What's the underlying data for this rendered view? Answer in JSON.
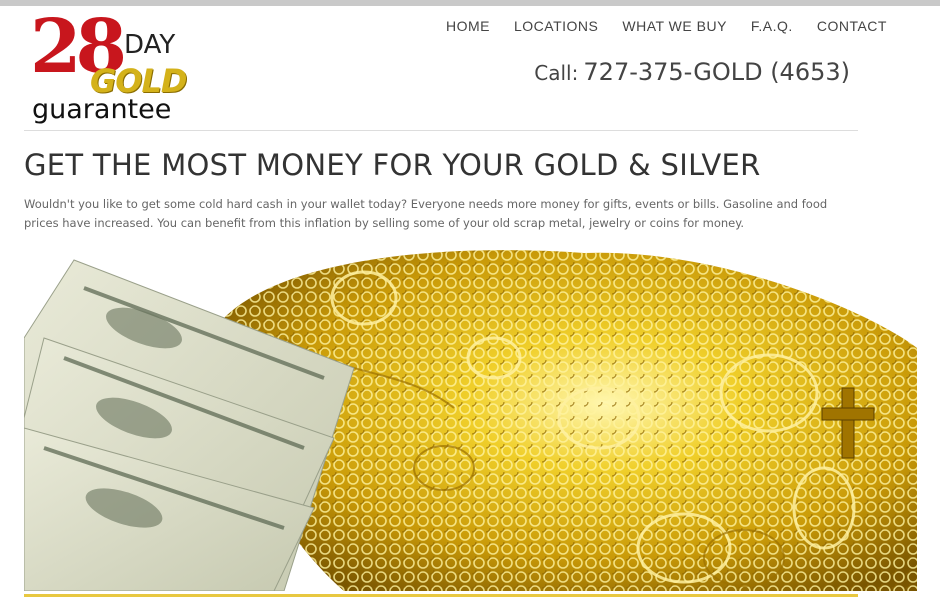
{
  "logo": {
    "number": "28",
    "day": "DAY",
    "gold": "GOLD",
    "guarantee": "guarantee"
  },
  "nav": {
    "items": [
      {
        "label": "HOME"
      },
      {
        "label": "LOCATIONS"
      },
      {
        "label": "WHAT WE BUY"
      },
      {
        "label": "F.A.Q."
      },
      {
        "label": "CONTACT"
      }
    ]
  },
  "phone": {
    "prefix": "Call:",
    "number": "727-375-GOLD (4653)"
  },
  "main": {
    "heading": "GET THE MOST MONEY FOR YOUR GOLD & SILVER",
    "intro": "Wouldn't you like to get some cold hard cash in your wallet today? Everyone needs more money for gifts, events or bills. Gasoline and food prices have increased. You can benefit from this inflation by selling some of your old scrap metal, jewelry or coins for money."
  },
  "colors": {
    "brand_red": "#c8161d",
    "brand_gold": "#d4b21a",
    "accent_bar": "#e8c840"
  },
  "hero": {
    "icon": "money-and-gold-jewelry-image"
  }
}
